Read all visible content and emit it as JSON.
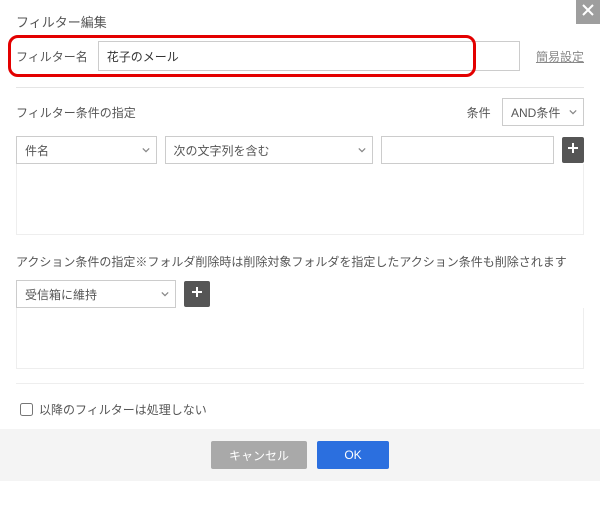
{
  "dialog": {
    "title": "フィルター編集",
    "simple_settings": "簡易設定"
  },
  "name": {
    "label": "フィルター名",
    "value": "花子のメール"
  },
  "conditions": {
    "heading": "フィルター条件の指定",
    "label": "条件",
    "selected_logic": "AND条件",
    "row": {
      "field": "件名",
      "op": "次の文字列を含む",
      "value": ""
    }
  },
  "actions": {
    "heading": "アクション条件の指定※フォルダ削除時は削除対象フォルダを指定したアクション条件も削除されます",
    "row": {
      "action": "受信箱に維持"
    }
  },
  "stop": {
    "label": "以降のフィルターは処理しない"
  },
  "buttons": {
    "cancel": "キャンセル",
    "ok": "OK"
  }
}
